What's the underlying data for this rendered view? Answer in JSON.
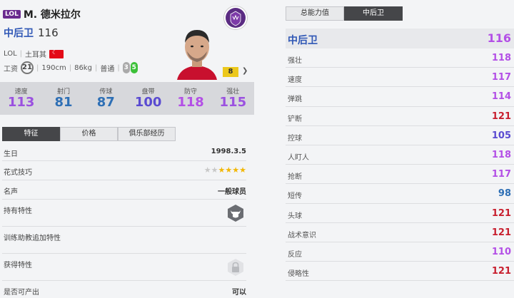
{
  "player": {
    "season_badge": "LOL",
    "name": "M. 德米拉尔",
    "position": "中后卫",
    "position_rating": "116",
    "league": "LOL",
    "nationality": "土耳其",
    "wage_label": "工资",
    "wage": "21",
    "height": "190cm",
    "weight": "86kg",
    "body_type": "普通",
    "weak_foot_left": "3",
    "weak_foot_right": "5",
    "level": "8"
  },
  "summary_stats": [
    {
      "label": "速度",
      "value": "113",
      "color": "#9b51e0"
    },
    {
      "label": "射门",
      "value": "81",
      "color": "#2e6fb5"
    },
    {
      "label": "传球",
      "value": "87",
      "color": "#2e6fb5"
    },
    {
      "label": "盘带",
      "value": "100",
      "color": "#5a4bd1"
    },
    {
      "label": "防守",
      "value": "118",
      "color": "#b34fe6"
    },
    {
      "label": "强壮",
      "value": "115",
      "color": "#9b51e0"
    }
  ],
  "tabs": [
    "特征",
    "价格",
    "俱乐部经历"
  ],
  "details": {
    "birthday_label": "生日",
    "birthday": "1998.3.5",
    "skill_label": "花式技巧",
    "skill_stars": 4,
    "skill_stars_total": 6,
    "reputation_label": "名声",
    "reputation": "一般球员",
    "traits_label": "持有特性",
    "trait_icon": "bull-icon",
    "coach_label": "训练助教追加特性",
    "acquire_label": "获得特性",
    "acquire_icon": "lock-icon",
    "tradable_label": "是否可产出",
    "tradable": "可以"
  },
  "right_tabs": [
    "总能力值",
    "中后卫"
  ],
  "overall": {
    "label": "中后卫",
    "value": "116"
  },
  "attributes": [
    {
      "label": "强壮",
      "value": "118",
      "color": "#b34fe6"
    },
    {
      "label": "速度",
      "value": "117",
      "color": "#b34fe6"
    },
    {
      "label": "弹跳",
      "value": "114",
      "color": "#b34fe6"
    },
    {
      "label": "铲断",
      "value": "121",
      "color": "#c8202f"
    },
    {
      "label": "控球",
      "value": "105",
      "color": "#5a4bd1"
    },
    {
      "label": "人盯人",
      "value": "118",
      "color": "#b34fe6"
    },
    {
      "label": "抢断",
      "value": "117",
      "color": "#b34fe6"
    },
    {
      "label": "短传",
      "value": "98",
      "color": "#2e6fb5"
    },
    {
      "label": "头球",
      "value": "121",
      "color": "#c8202f"
    },
    {
      "label": "战术意识",
      "value": "121",
      "color": "#c8202f"
    },
    {
      "label": "反应",
      "value": "110",
      "color": "#b34fe6"
    },
    {
      "label": "侵略性",
      "value": "121",
      "color": "#c8202f"
    }
  ]
}
